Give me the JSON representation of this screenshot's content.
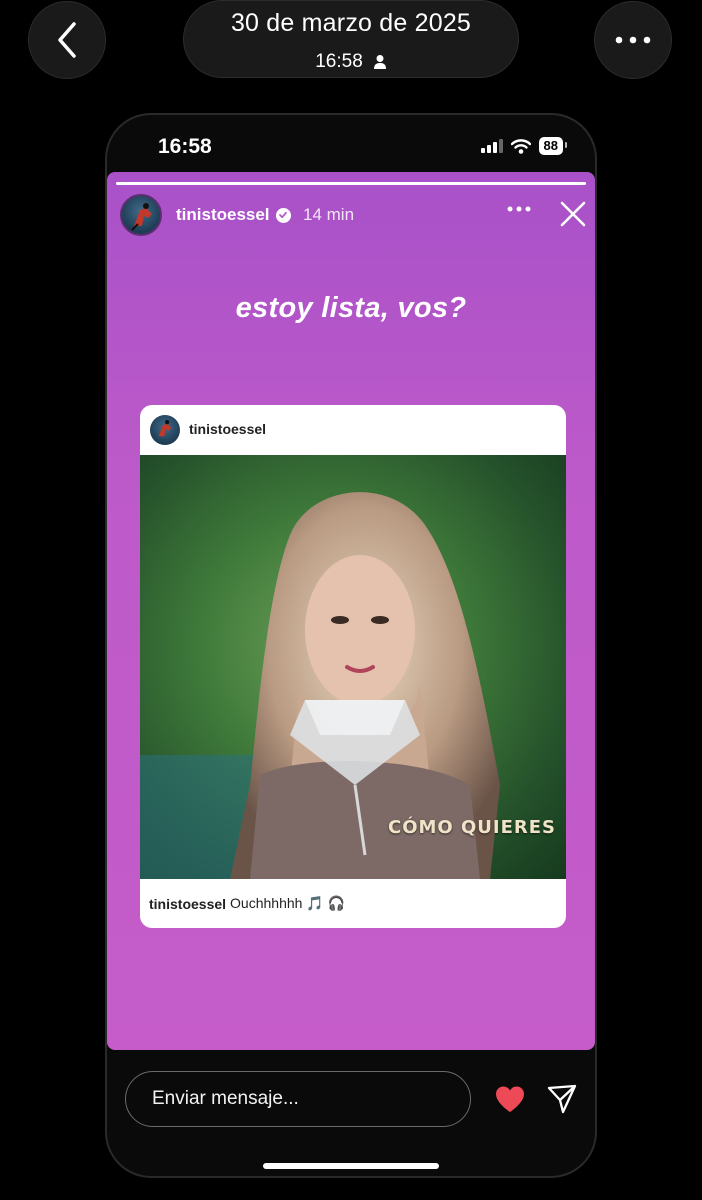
{
  "viewer": {
    "date": "30 de marzo de 2025",
    "time": "16:58"
  },
  "status_bar": {
    "time": "16:58",
    "battery": "88"
  },
  "story": {
    "progress": 1.0,
    "username": "tinistoessel",
    "elapsed": "14 min",
    "headline": "estoy lista, vos?",
    "post": {
      "username": "tinistoessel",
      "photo_overlay_text": "CÓMO QUIERES",
      "caption_user": "tinistoessel",
      "caption_text": "Ouchhhhhh 🎵 🎧"
    }
  },
  "reply": {
    "placeholder": "Enviar mensaje...",
    "heart_color": "#ed4956"
  }
}
